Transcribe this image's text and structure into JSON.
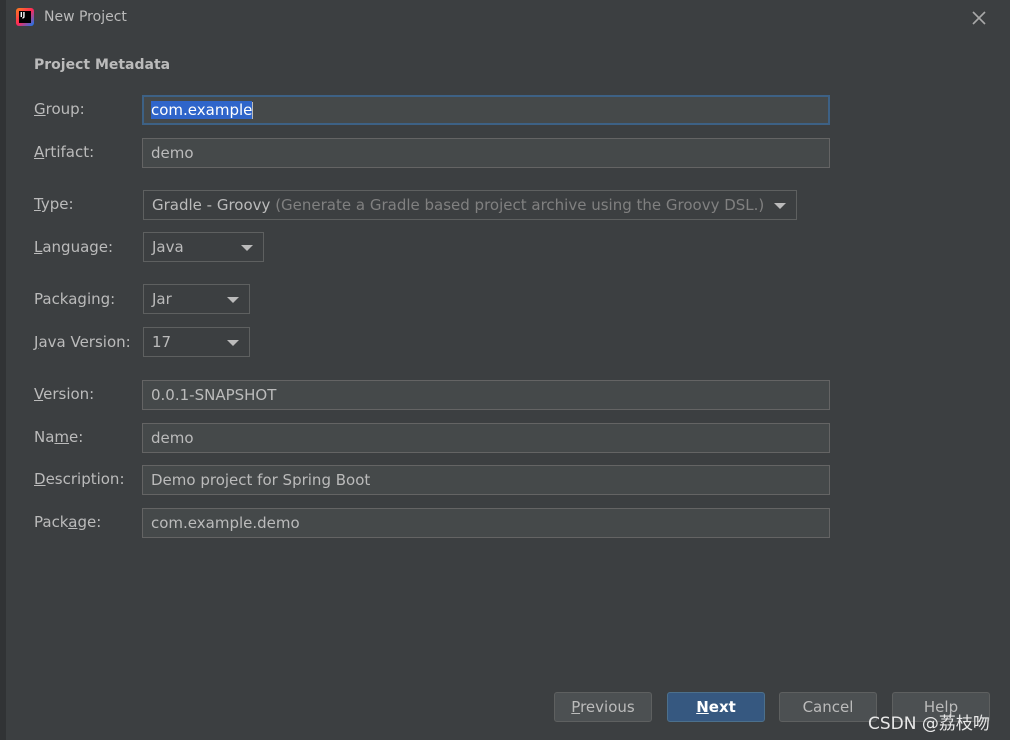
{
  "window": {
    "title": "New Project",
    "icon_label": "IJ"
  },
  "section": {
    "title": "Project Metadata"
  },
  "fields": {
    "group": {
      "label_pre": "",
      "label_u": "G",
      "label_post": "roup:",
      "value": "com.example"
    },
    "artifact": {
      "label_pre": "",
      "label_u": "A",
      "label_post": "rtifact:",
      "value": "demo"
    },
    "type": {
      "label_pre": "",
      "label_u": "T",
      "label_post": "ype:",
      "value": "Gradle - Groovy",
      "hint": "(Generate a Gradle based project archive using the Groovy DSL.)"
    },
    "language": {
      "label_pre": "",
      "label_u": "L",
      "label_post": "anguage:",
      "value": "Java"
    },
    "packaging": {
      "label": "Packaging:",
      "value": "Jar"
    },
    "java_version": {
      "label_pre": "",
      "label_u": "J",
      "label_post": "ava Version:",
      "value": "17"
    },
    "version": {
      "label_pre": "",
      "label_u": "V",
      "label_post": "ersion:",
      "value": "0.0.1-SNAPSHOT"
    },
    "name": {
      "label_pre": "Na",
      "label_u": "m",
      "label_post": "e:",
      "value": "demo"
    },
    "description": {
      "label_pre": "",
      "label_u": "D",
      "label_post": "escription:",
      "value": "Demo project for Spring Boot"
    },
    "package": {
      "label_pre": "Pack",
      "label_u": "a",
      "label_post": "ge:",
      "value": "com.example.demo"
    }
  },
  "buttons": {
    "previous": {
      "u": "P",
      "rest": "revious"
    },
    "next": {
      "u": "N",
      "rest": "ext"
    },
    "cancel": "Cancel",
    "help": "Help"
  },
  "watermark": "CSDN @荔枝吻",
  "colors": {
    "dialog_bg": "#3c3f41",
    "input_bg": "#45494a",
    "focus_border": "#3d6185",
    "primary_button": "#365880",
    "selection": "#2f65ca"
  }
}
